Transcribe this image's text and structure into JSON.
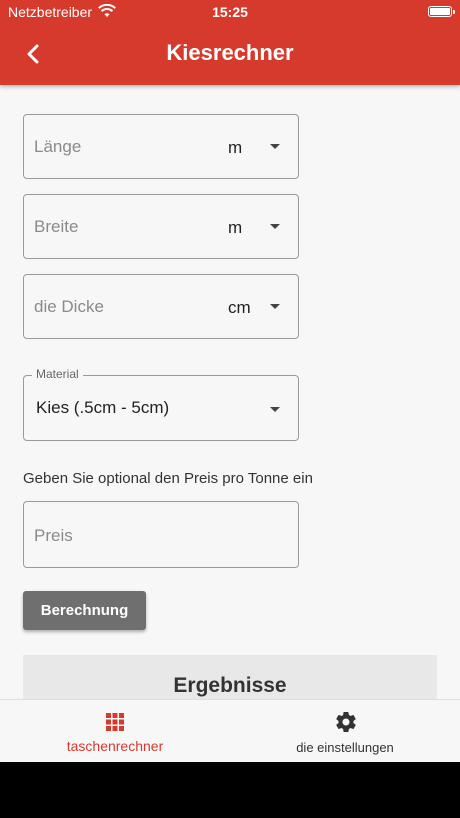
{
  "status_bar": {
    "carrier": "Netzbetreiber",
    "time": "15:25",
    "wifi_icon": "wifi-icon",
    "battery_icon": "battery-icon"
  },
  "app_bar": {
    "title": "Kiesrechner",
    "back_icon": "back-arrow-icon",
    "color": "#d63a2c"
  },
  "form": {
    "length": {
      "placeholder": "Länge",
      "unit": "m"
    },
    "width": {
      "placeholder": "Breite",
      "unit": "m"
    },
    "thickness": {
      "placeholder": "die Dicke",
      "unit": "cm"
    },
    "material": {
      "label": "Material",
      "value": "Kies (.5cm - 5cm)"
    },
    "price_hint": "Geben Sie optional den Preis pro Tonne ein",
    "price": {
      "placeholder": "Preis"
    },
    "calculate_label": "Berechnung"
  },
  "results": {
    "title": "Ergebnisse"
  },
  "bottom_nav": {
    "items": [
      {
        "label": "taschenrechner",
        "icon": "grid-icon",
        "active": true
      },
      {
        "label": "die einstellungen",
        "icon": "gear-icon",
        "active": false
      }
    ]
  }
}
